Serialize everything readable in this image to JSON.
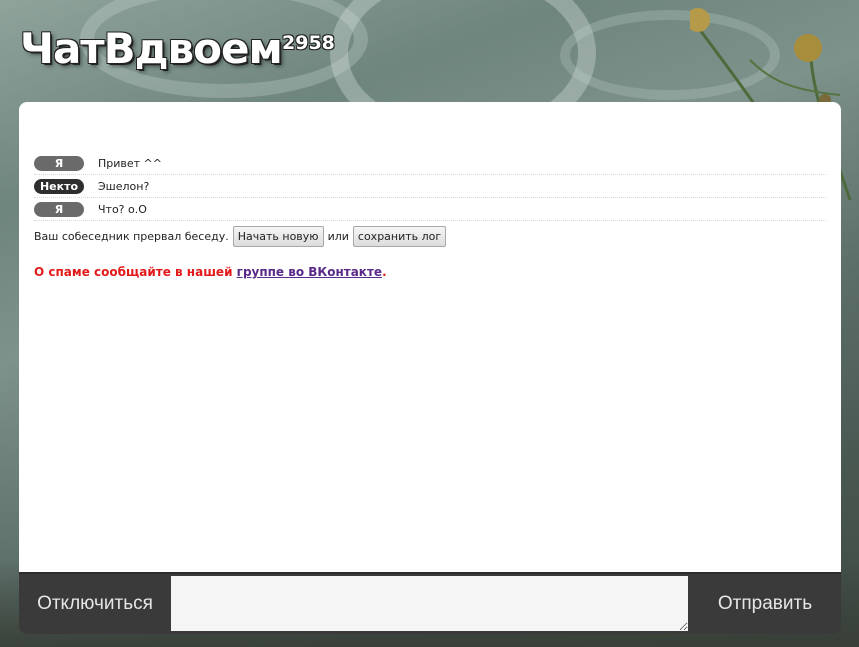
{
  "header": {
    "logo": "ЧатВдвоем",
    "online_count": "2958"
  },
  "log": {
    "messages": [
      {
        "sender": "Я",
        "text": "Привет ^^"
      },
      {
        "sender": "Некто",
        "text": "Эшелон?"
      },
      {
        "sender": "Я",
        "text": "Что? о.О"
      }
    ],
    "status_text": "Ваш собеседник прервал беседу.",
    "start_new_label": "Начать новую",
    "or_text": "или",
    "save_log_label": "сохранить лог",
    "spam_prefix": "О спаме сообщайте в нашей ",
    "spam_link": "группе во ВКонтакте",
    "spam_suffix": "."
  },
  "bottom": {
    "disconnect_label": "Отключиться",
    "send_label": "Отправить",
    "input_value": ""
  },
  "colors": {
    "badge_me": "#6a6a6a",
    "badge_stranger": "#2e2e2e",
    "spam_text": "#e21a1a",
    "link": "#5a2a8a",
    "bottom_bar": "#3a3a3a"
  }
}
